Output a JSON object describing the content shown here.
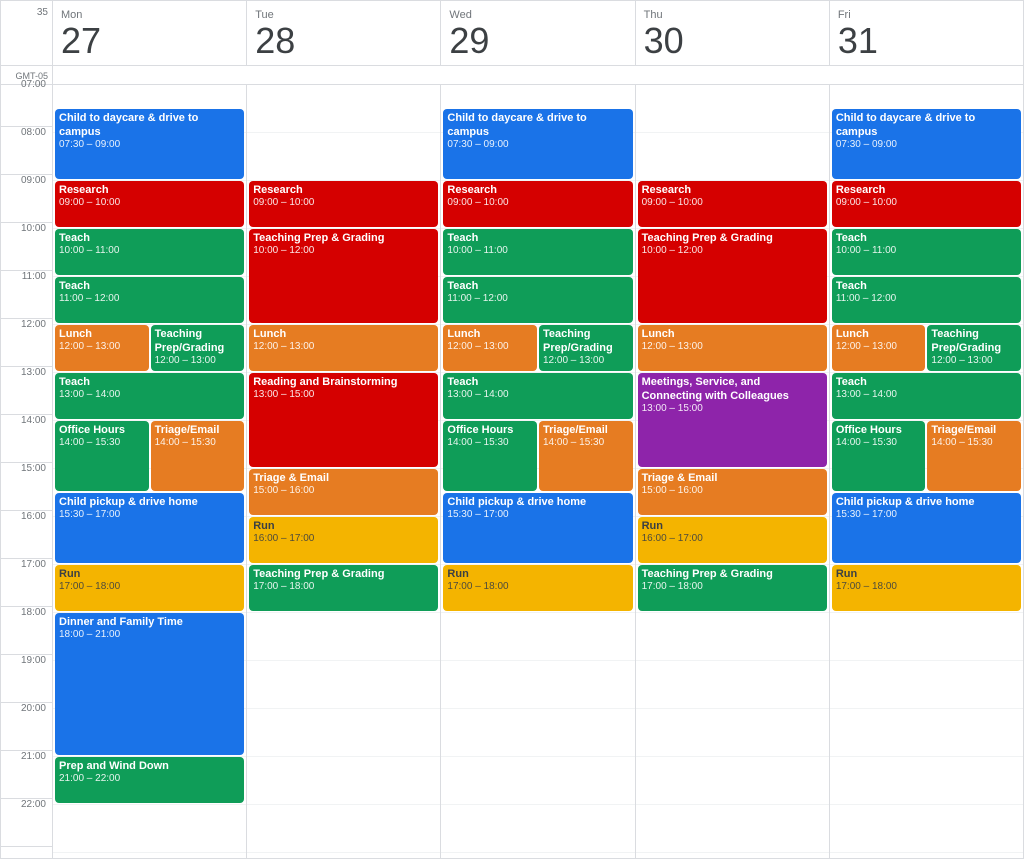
{
  "week_number": "35",
  "timezone": "GMT-05",
  "days": [
    {
      "name": "Mon",
      "number": "27"
    },
    {
      "name": "Tue",
      "number": "28"
    },
    {
      "name": "Wed",
      "number": "29"
    },
    {
      "name": "Thu",
      "number": "30"
    },
    {
      "name": "Fri",
      "number": "31"
    }
  ],
  "time_slots": [
    "07:00",
    "08:00",
    "09:00",
    "10:00",
    "11:00",
    "12:00",
    "13:00",
    "14:00",
    "15:00",
    "16:00",
    "17:00",
    "18:00",
    "19:00",
    "20:00",
    "21:00",
    "22:00"
  ],
  "events": {
    "mon": [
      {
        "title": "Child to daycare & drive to campus",
        "time": "07:30 – 09:00",
        "start": 7.5,
        "end": 9.0,
        "color": "blue",
        "split": "none"
      },
      {
        "title": "Research",
        "time": "09:00 – 10:00",
        "start": 9.0,
        "end": 10.0,
        "color": "red",
        "split": "none"
      },
      {
        "title": "Teach",
        "time": "10:00 – 11:00",
        "start": 10.0,
        "end": 11.0,
        "color": "green",
        "split": "none"
      },
      {
        "title": "Teach",
        "time": "11:00 – 12:00",
        "start": 11.0,
        "end": 12.0,
        "color": "green",
        "split": "none"
      },
      {
        "title": "Lunch",
        "time": "12:00 – 13:00",
        "start": 12.0,
        "end": 13.0,
        "color": "orange",
        "split": "left"
      },
      {
        "title": "Teaching Prep/Grading",
        "time": "12:00 – 13:00",
        "start": 12.0,
        "end": 13.0,
        "color": "green",
        "split": "right"
      },
      {
        "title": "Teach",
        "time": "13:00 – 14:00",
        "start": 13.0,
        "end": 14.0,
        "color": "green",
        "split": "none"
      },
      {
        "title": "Office Hours",
        "time": "14:00 – 15:30",
        "start": 14.0,
        "end": 15.5,
        "color": "green",
        "split": "left"
      },
      {
        "title": "Triage/Email",
        "time": "14:00 – 15:30",
        "start": 14.0,
        "end": 15.5,
        "color": "orange",
        "split": "right"
      },
      {
        "title": "Child pickup & drive home",
        "time": "15:30 – 17:00",
        "start": 15.5,
        "end": 17.0,
        "color": "blue",
        "split": "none"
      },
      {
        "title": "Run",
        "time": "17:00 – 18:00",
        "start": 17.0,
        "end": 18.0,
        "color": "yellow",
        "split": "none"
      },
      {
        "title": "Dinner and Family Time",
        "time": "18:00 – 21:00",
        "start": 18.0,
        "end": 21.0,
        "color": "blue",
        "split": "none"
      },
      {
        "title": "Prep and Wind Down",
        "time": "21:00 – 22:00",
        "start": 21.0,
        "end": 22.0,
        "color": "green",
        "split": "none"
      }
    ],
    "tue": [
      {
        "title": "Research",
        "time": "09:00 – 10:00",
        "start": 9.0,
        "end": 10.0,
        "color": "red",
        "split": "none"
      },
      {
        "title": "Teaching Prep & Grading",
        "time": "10:00 – 12:00",
        "start": 10.0,
        "end": 12.0,
        "color": "red",
        "split": "none"
      },
      {
        "title": "Lunch",
        "time": "12:00 – 13:00",
        "start": 12.0,
        "end": 13.0,
        "color": "orange",
        "split": "none"
      },
      {
        "title": "Reading and Brainstorming",
        "time": "13:00 – 15:00",
        "start": 13.0,
        "end": 15.0,
        "color": "red",
        "split": "none"
      },
      {
        "title": "Triage & Email",
        "time": "15:00 – 16:00",
        "start": 15.0,
        "end": 16.0,
        "color": "orange",
        "split": "none"
      },
      {
        "title": "Run",
        "time": "16:00 – 17:00",
        "start": 16.0,
        "end": 17.0,
        "color": "yellow",
        "split": "none"
      },
      {
        "title": "Teaching Prep & Grading",
        "time": "17:00 – 18:00",
        "start": 17.0,
        "end": 18.0,
        "color": "green",
        "split": "none"
      }
    ],
    "wed": [
      {
        "title": "Child to daycare & drive to campus",
        "time": "07:30 – 09:00",
        "start": 7.5,
        "end": 9.0,
        "color": "blue",
        "split": "none"
      },
      {
        "title": "Research",
        "time": "09:00 – 10:00",
        "start": 9.0,
        "end": 10.0,
        "color": "red",
        "split": "none"
      },
      {
        "title": "Teach",
        "time": "10:00 – 11:00",
        "start": 10.0,
        "end": 11.0,
        "color": "green",
        "split": "none"
      },
      {
        "title": "Teach",
        "time": "11:00 – 12:00",
        "start": 11.0,
        "end": 12.0,
        "color": "green",
        "split": "none"
      },
      {
        "title": "Lunch",
        "time": "12:00 – 13:00",
        "start": 12.0,
        "end": 13.0,
        "color": "orange",
        "split": "left"
      },
      {
        "title": "Teaching Prep/Grading",
        "time": "12:00 – 13:00",
        "start": 12.0,
        "end": 13.0,
        "color": "green",
        "split": "right"
      },
      {
        "title": "Teach",
        "time": "13:00 – 14:00",
        "start": 13.0,
        "end": 14.0,
        "color": "green",
        "split": "none"
      },
      {
        "title": "Office Hours",
        "time": "14:00 – 15:30",
        "start": 14.0,
        "end": 15.5,
        "color": "green",
        "split": "left"
      },
      {
        "title": "Triage/Email",
        "time": "14:00 – 15:30",
        "start": 14.0,
        "end": 15.5,
        "color": "orange",
        "split": "right"
      },
      {
        "title": "Child pickup & drive home",
        "time": "15:30 – 17:00",
        "start": 15.5,
        "end": 17.0,
        "color": "blue",
        "split": "none"
      },
      {
        "title": "Run",
        "time": "17:00 – 18:00",
        "start": 17.0,
        "end": 18.0,
        "color": "yellow",
        "split": "none"
      }
    ],
    "thu": [
      {
        "title": "Research",
        "time": "09:00 – 10:00",
        "start": 9.0,
        "end": 10.0,
        "color": "red",
        "split": "none"
      },
      {
        "title": "Teaching Prep & Grading",
        "time": "10:00 – 12:00",
        "start": 10.0,
        "end": 12.0,
        "color": "red",
        "split": "none"
      },
      {
        "title": "Lunch",
        "time": "12:00 – 13:00",
        "start": 12.0,
        "end": 13.0,
        "color": "orange",
        "split": "none"
      },
      {
        "title": "Meetings, Service, and Connecting with Colleagues",
        "time": "13:00 – 15:00",
        "start": 13.0,
        "end": 15.0,
        "color": "purple",
        "split": "none"
      },
      {
        "title": "Triage & Email",
        "time": "15:00 – 16:00",
        "start": 15.0,
        "end": 16.0,
        "color": "orange",
        "split": "none"
      },
      {
        "title": "Run",
        "time": "16:00 – 17:00",
        "start": 16.0,
        "end": 17.0,
        "color": "yellow",
        "split": "none"
      },
      {
        "title": "Teaching Prep & Grading",
        "time": "17:00 – 18:00",
        "start": 17.0,
        "end": 18.0,
        "color": "green",
        "split": "none"
      }
    ],
    "fri": [
      {
        "title": "Child to daycare & drive to campus",
        "time": "07:30 – 09:00",
        "start": 7.5,
        "end": 9.0,
        "color": "blue",
        "split": "none"
      },
      {
        "title": "Research",
        "time": "09:00 – 10:00",
        "start": 9.0,
        "end": 10.0,
        "color": "red",
        "split": "none"
      },
      {
        "title": "Teach",
        "time": "10:00 – 11:00",
        "start": 10.0,
        "end": 11.0,
        "color": "green",
        "split": "none"
      },
      {
        "title": "Teach",
        "time": "11:00 – 12:00",
        "start": 11.0,
        "end": 12.0,
        "color": "green",
        "split": "none"
      },
      {
        "title": "Lunch",
        "time": "12:00 – 13:00",
        "start": 12.0,
        "end": 13.0,
        "color": "orange",
        "split": "left"
      },
      {
        "title": "Teaching Prep/Grading",
        "time": "12:00 – 13:00",
        "start": 12.0,
        "end": 13.0,
        "color": "green",
        "split": "right"
      },
      {
        "title": "Teach",
        "time": "13:00 – 14:00",
        "start": 13.0,
        "end": 14.0,
        "color": "green",
        "split": "none"
      },
      {
        "title": "Office Hours",
        "time": "14:00 – 15:30",
        "start": 14.0,
        "end": 15.5,
        "color": "green",
        "split": "left"
      },
      {
        "title": "Triage/Email",
        "time": "14:00 – 15:30",
        "start": 14.0,
        "end": 15.5,
        "color": "orange",
        "split": "right"
      },
      {
        "title": "Child pickup & drive home",
        "time": "15:30 – 17:00",
        "start": 15.5,
        "end": 17.0,
        "color": "blue",
        "split": "none"
      },
      {
        "title": "Run",
        "time": "17:00 – 18:00",
        "start": 17.0,
        "end": 18.0,
        "color": "yellow",
        "split": "none"
      }
    ]
  }
}
